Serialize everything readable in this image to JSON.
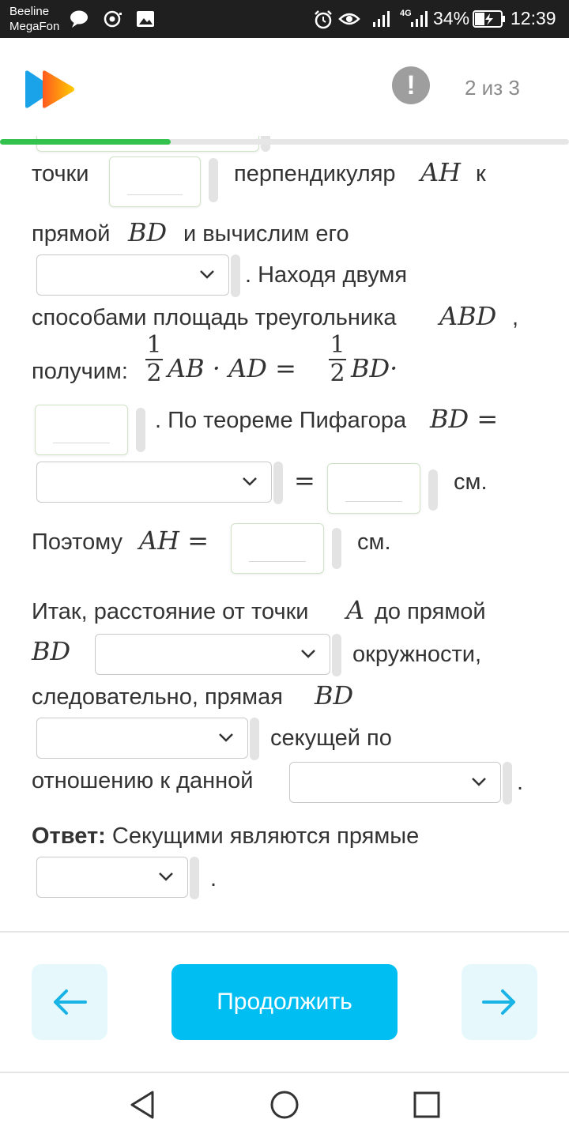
{
  "status_bar": {
    "carrier_1": "Beeline",
    "carrier_2": "MegaFon",
    "battery": "34%",
    "time": "12:39",
    "network": "4G"
  },
  "header": {
    "counter": "2 из 3",
    "warning_symbol": "!",
    "progress_fraction": 0.3
  },
  "content": {
    "l1_a": "точки",
    "l1_b": "перпендикуляр",
    "l1_m": "AH",
    "l1_c": "к",
    "l2_a": "прямой",
    "l2_m": "BD",
    "l2_b": "и вычислим его",
    "l3_a": ". Находя двумя",
    "l4_a": "способами площадь треугольника",
    "l4_m": "ABD",
    "l4_b": ",",
    "l5_a": "получим:",
    "frac_num": "1",
    "frac_den": "2",
    "l5_m1": "AB · AD =",
    "l5_m2": "BD·",
    "l6_a": ". По теореме Пифагора",
    "l6_m": "BD =",
    "l7_eq": "=",
    "l7_unit": "см.",
    "l8_a": "Поэтому",
    "l8_m": "AH =",
    "l8_unit": "см.",
    "p2_l1_a": "Итак, расстояние от точки",
    "p2_l1_m": "A",
    "p2_l1_b": "до прямой",
    "p2_l2_m": "BD",
    "p2_l2_a": "окружности,",
    "p2_l3_a": "следовательно, прямая",
    "p2_l3_m": "BD",
    "p2_l4_a": "секущей по",
    "p2_l5_a": "отношению к данной",
    "p2_l5_b": ".",
    "answer_label": "Ответ:",
    "answer_text": "Секущими являются прямые",
    "answer_end": "."
  },
  "buttons": {
    "continue": "Продолжить",
    "back_icon": "arrow-left-icon",
    "forward_icon": "arrow-right-icon"
  },
  "colors": {
    "accent": "#00bdf2",
    "progress": "#33c24d",
    "nav_button_bg": "#e6f8fc"
  }
}
